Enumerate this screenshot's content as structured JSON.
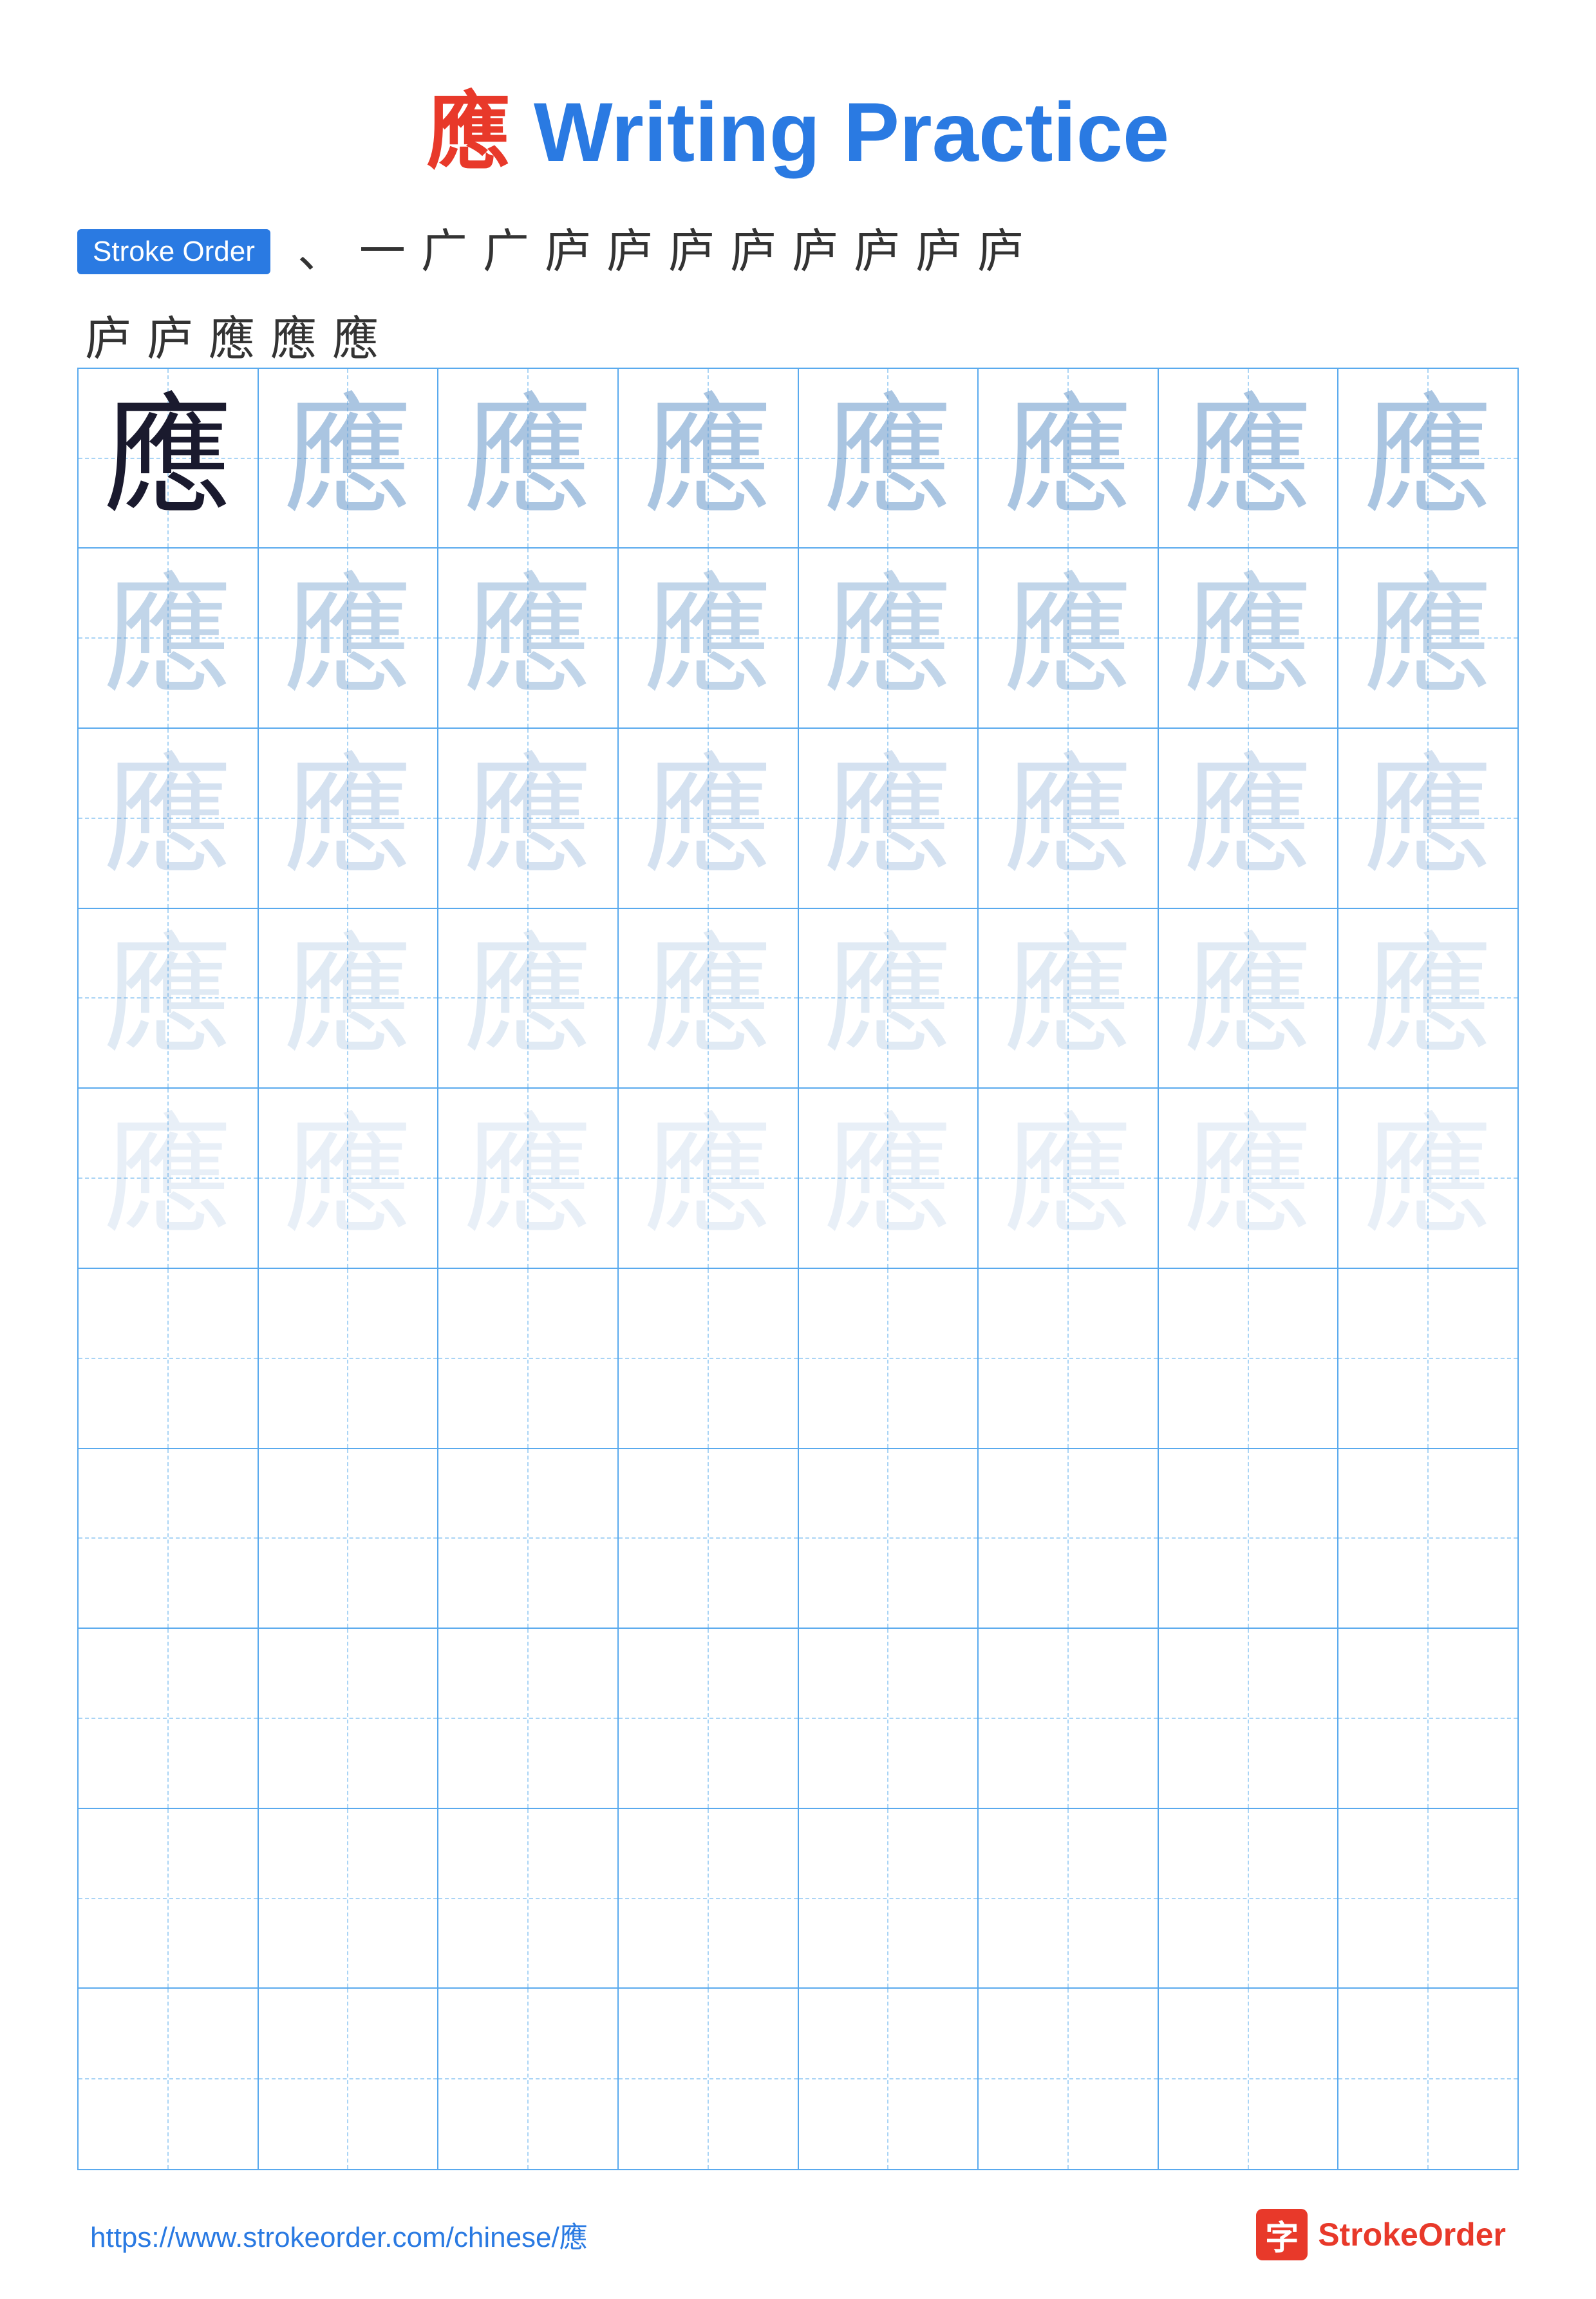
{
  "page": {
    "title_char": "應",
    "title_text": " Writing Practice"
  },
  "stroke_order": {
    "badge_label": "Stroke Order",
    "strokes_row1": [
      "、",
      "一",
      "广",
      "广",
      "庐",
      "庐",
      "庐",
      "庐",
      "庐",
      "庐",
      "庐",
      "庐"
    ],
    "strokes_row2": [
      "庐",
      "庐",
      "應",
      "應",
      "應"
    ]
  },
  "grid": {
    "rows": 10,
    "cols": 8,
    "char": "應",
    "filled_rows": 5
  },
  "footer": {
    "url": "https://www.strokeorder.com/chinese/應",
    "brand_char": "字",
    "brand_name": "StrokeOrder"
  }
}
